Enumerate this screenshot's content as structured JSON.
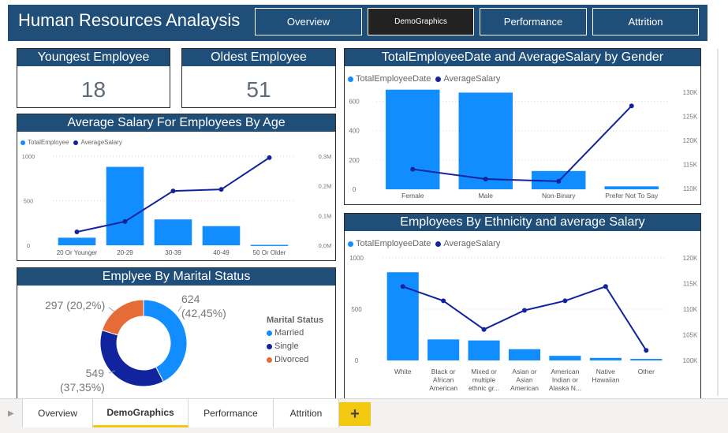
{
  "header": {
    "title": "Human Resources Analaysis",
    "nav": [
      "Overview",
      "DemoGraphics",
      "Performance",
      "Attrition"
    ],
    "active_nav": "DemoGraphics"
  },
  "kpis": {
    "youngest": {
      "label": "Youngest Employee",
      "value": "18"
    },
    "oldest": {
      "label": "Oldest Employee",
      "value": "51"
    }
  },
  "legend": {
    "total": "TotalEmployee",
    "total_date": "TotalEmployeeDate",
    "salary": "AverageSalary"
  },
  "marital_legend_title": "Marital Status",
  "tabs": [
    "Overview",
    "DemoGraphics",
    "Performance",
    "Attrition"
  ],
  "active_tab": "DemoGraphics",
  "add_tab_icon": "+",
  "colors": {
    "header": "#1f4e79",
    "bar": "#118dff",
    "line": "#12239e",
    "divorced": "#e66c37",
    "accent": "#f2c811"
  },
  "chart_data": [
    {
      "type": "bar",
      "id": "age",
      "title": "Average Salary For Employees By Age",
      "categories": [
        "20 Or Younger",
        "20-29",
        "30-39",
        "40-49",
        "50 Or Older"
      ],
      "series": [
        {
          "name": "TotalEmployee",
          "values": [
            85,
            880,
            290,
            215,
            5
          ]
        },
        {
          "name": "AverageSalary",
          "type": "line",
          "values": [
            45000,
            80000,
            183000,
            188000,
            295000
          ]
        }
      ],
      "y_ticks_left": [
        "1000",
        "500",
        "0"
      ],
      "y_ticks_right": [
        "0,3M",
        "0,2M",
        "0,1M",
        "0,0M"
      ],
      "ylim": [
        0,
        1000
      ],
      "y2lim": [
        0,
        300000
      ]
    },
    {
      "type": "bar",
      "id": "gender",
      "title": "TotalEmployeeDate and AverageSalary by Gender",
      "categories": [
        "Female",
        "Male",
        "Non-Binary",
        "Prefer Not To Say"
      ],
      "series": [
        {
          "name": "TotalEmployeeDate",
          "values": [
            680,
            660,
            125,
            20
          ]
        },
        {
          "name": "AverageSalary",
          "type": "line",
          "values": [
            114000,
            111800,
            111300,
            128200
          ]
        }
      ],
      "y_ticks_left": [
        "600",
        "400",
        "200",
        "0"
      ],
      "y_ticks_right": [
        "130K",
        "125K",
        "120K",
        "115K",
        "110K"
      ],
      "ylim": [
        0,
        700
      ],
      "y2lim": [
        109500,
        132500
      ]
    },
    {
      "type": "bar",
      "id": "ethnicity",
      "title": "Employees By Ethnicity and average Salary",
      "categories": [
        "White",
        "Black or African American",
        "Mixed or multiple ethnic gr...",
        "Asian or Asian American",
        "American Indian or Alaska N...",
        "Native Hawaiian",
        "Other"
      ],
      "category_lines": [
        [
          "White"
        ],
        [
          "Black or",
          "African",
          "American"
        ],
        [
          "Mixed or",
          "multiple",
          "ethnic gr..."
        ],
        [
          "Asian or",
          "Asian",
          "American"
        ],
        [
          "American",
          "Indian or",
          "Alaska N..."
        ],
        [
          "Native",
          "Hawaiian"
        ],
        [
          "Other"
        ]
      ],
      "series": [
        {
          "name": "TotalEmployeeDate",
          "values": [
            860,
            205,
            195,
            110,
            45,
            25,
            15
          ]
        },
        {
          "name": "AverageSalary",
          "type": "line",
          "values": [
            115000,
            112000,
            106000,
            110000,
            112000,
            115000,
            101600
          ]
        }
      ],
      "y_ticks_left": [
        "1000",
        "500",
        "0"
      ],
      "y_ticks_right": [
        "120K",
        "115K",
        "110K",
        "105K",
        "100K"
      ],
      "ylim": [
        0,
        1000
      ],
      "y2lim": [
        99500,
        121000
      ]
    },
    {
      "type": "pie",
      "id": "marital",
      "title": "Emplyee By Marital Status",
      "categories": [
        "Married",
        "Single",
        "Divorced"
      ],
      "values": [
        624,
        549,
        297
      ],
      "labels": [
        "624 (42,45%)",
        "549 (37,35%)",
        "297 (20,2%)"
      ],
      "label_lines": [
        [
          "624",
          "(42,45%)"
        ],
        [
          "549",
          "(37,35%)"
        ],
        [
          "297 (20,2%)"
        ]
      ]
    }
  ]
}
